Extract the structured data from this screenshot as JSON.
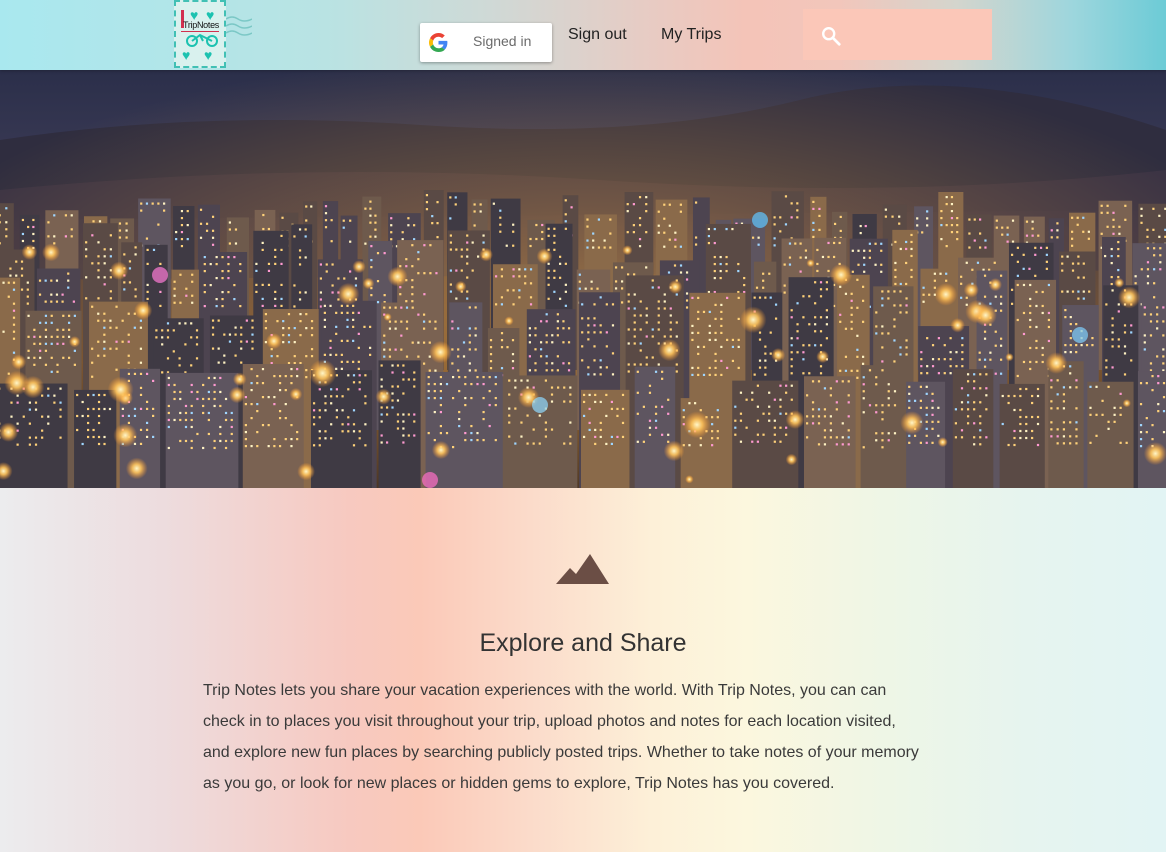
{
  "header": {
    "logo_text": "TripNotes",
    "google_button_label": "Signed in",
    "nav": [
      {
        "label": "Sign out"
      },
      {
        "label": "My Trips"
      }
    ],
    "search": {
      "placeholder": "",
      "value": ""
    }
  },
  "hero": {
    "image": "night-city-skyline"
  },
  "about": {
    "icon": "mountain-icon",
    "title": "Explore and Share",
    "body_lines": [
      "Trip Notes lets you share your vacation experiences with the world. With Trip Notes, you can can",
      "check in to places you visit throughout your trip, upload photos and notes for each location visited,",
      "and explore new fun places by searching publicly posted trips. Whether to take notes of your memory",
      "as you go, or look for new places or hidden gems to explore, Trip Notes has you covered."
    ]
  },
  "colors": {
    "accent_teal": "#41c0b4",
    "search_bg": "#fbc7b8",
    "mountain": "#6b4e45"
  }
}
